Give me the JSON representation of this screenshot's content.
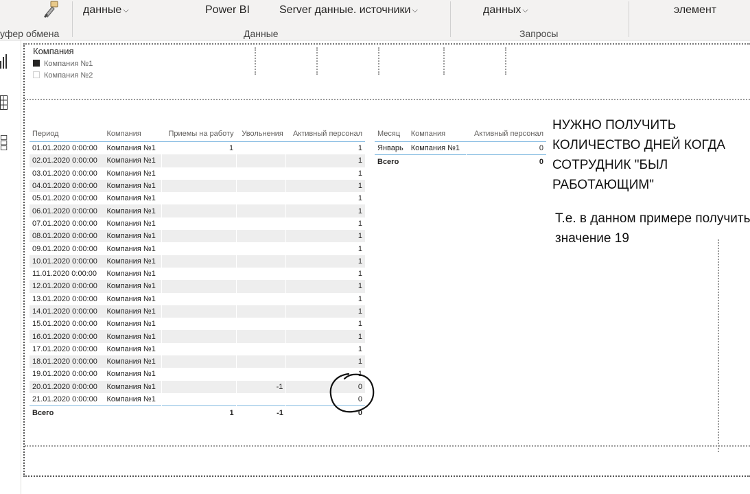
{
  "ribbon": {
    "clipboard_group": "уфер обмена",
    "data_dropdown": "данные",
    "powerbi_button": "Power BI",
    "server_sources": "Server  данные. источники",
    "data_group": "Данные",
    "data_dropdown2": "данных",
    "queries_group": "Запросы",
    "element_button": "элемент"
  },
  "legend": {
    "title": "Компания",
    "items": [
      {
        "label": "Компания №1",
        "color": "#252423"
      },
      {
        "label": "Компания №2",
        "color": "#ffffff"
      }
    ]
  },
  "table_daily": {
    "headers": [
      "Период",
      "Компания",
      "Приемы на работу",
      "Увольнения",
      "Активный персонал"
    ],
    "rows": [
      [
        "01.01.2020 0:00:00",
        "Компания №1",
        "1",
        "",
        "1"
      ],
      [
        "02.01.2020 0:00:00",
        "Компания №1",
        "",
        "",
        "1"
      ],
      [
        "03.01.2020 0:00:00",
        "Компания №1",
        "",
        "",
        "1"
      ],
      [
        "04.01.2020 0:00:00",
        "Компания №1",
        "",
        "",
        "1"
      ],
      [
        "05.01.2020 0:00:00",
        "Компания №1",
        "",
        "",
        "1"
      ],
      [
        "06.01.2020 0:00:00",
        "Компания №1",
        "",
        "",
        "1"
      ],
      [
        "07.01.2020 0:00:00",
        "Компания №1",
        "",
        "",
        "1"
      ],
      [
        "08.01.2020 0:00:00",
        "Компания №1",
        "",
        "",
        "1"
      ],
      [
        "09.01.2020 0:00:00",
        "Компания №1",
        "",
        "",
        "1"
      ],
      [
        "10.01.2020 0:00:00",
        "Компания №1",
        "",
        "",
        "1"
      ],
      [
        "11.01.2020 0:00:00",
        "Компания №1",
        "",
        "",
        "1"
      ],
      [
        "12.01.2020 0:00:00",
        "Компания №1",
        "",
        "",
        "1"
      ],
      [
        "13.01.2020 0:00:00",
        "Компания №1",
        "",
        "",
        "1"
      ],
      [
        "14.01.2020 0:00:00",
        "Компания №1",
        "",
        "",
        "1"
      ],
      [
        "15.01.2020 0:00:00",
        "Компания №1",
        "",
        "",
        "1"
      ],
      [
        "16.01.2020 0:00:00",
        "Компания №1",
        "",
        "",
        "1"
      ],
      [
        "17.01.2020 0:00:00",
        "Компания №1",
        "",
        "",
        "1"
      ],
      [
        "18.01.2020 0:00:00",
        "Компания №1",
        "",
        "",
        "1"
      ],
      [
        "19.01.2020 0:00:00",
        "Компания №1",
        "",
        "",
        "1"
      ],
      [
        "20.01.2020 0:00:00",
        "Компания №1",
        "",
        "-1",
        "0"
      ],
      [
        "21.01.2020 0:00:00",
        "Компания №1",
        "",
        "",
        "0"
      ]
    ],
    "total": [
      "Всего",
      "",
      "1",
      "-1",
      "0"
    ]
  },
  "table_monthly": {
    "headers": [
      "Месяц",
      "Компания",
      "Активный персонал"
    ],
    "rows": [
      [
        "Январь",
        "Компания №1",
        "0"
      ]
    ],
    "total": [
      "Всего",
      "",
      "0"
    ]
  },
  "annotation": {
    "main": "НУЖНО ПОЛУЧИТЬ КОЛИЧЕСТВО ДНЕЙ КОГДА СОТРУДНИК \"БЫЛ РАБОТАЮЩИМ\"",
    "sub": "Т.е. в данном примере получить значение 19"
  }
}
